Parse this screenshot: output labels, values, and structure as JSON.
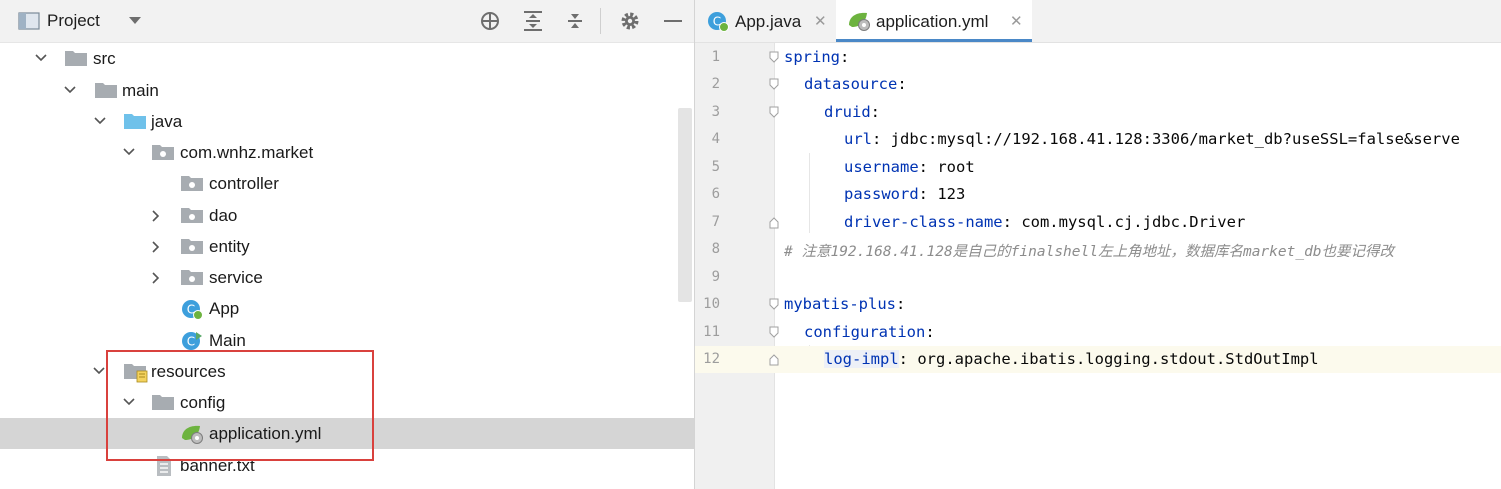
{
  "project_panel": {
    "title": "Project",
    "tree": [
      {
        "label": "src",
        "icon": "folder-icon",
        "expanded": true
      },
      {
        "label": "main",
        "icon": "folder-icon",
        "expanded": true
      },
      {
        "label": "java",
        "icon": "source-folder-icon",
        "expanded": true
      },
      {
        "label": "com.wnhz.market",
        "icon": "package-icon",
        "expanded": true
      },
      {
        "label": "controller",
        "icon": "package-icon"
      },
      {
        "label": "dao",
        "icon": "package-icon",
        "expanded": false
      },
      {
        "label": "entity",
        "icon": "package-icon",
        "expanded": false
      },
      {
        "label": "service",
        "icon": "package-icon",
        "expanded": false
      },
      {
        "label": "App",
        "icon": "spring-class-icon"
      },
      {
        "label": "Main",
        "icon": "class-icon"
      },
      {
        "label": "resources",
        "icon": "resources-folder-icon",
        "expanded": true
      },
      {
        "label": "config",
        "icon": "folder-icon",
        "expanded": true
      },
      {
        "label": "application.yml",
        "icon": "spring-yaml-icon",
        "selected": true
      },
      {
        "label": "banner.txt",
        "icon": "text-file-icon"
      }
    ]
  },
  "editor": {
    "tabs": [
      {
        "label": "App.java",
        "icon": "spring-class-icon",
        "active": false
      },
      {
        "label": "application.yml",
        "icon": "spring-yaml-icon",
        "active": true
      }
    ],
    "lines": [
      {
        "no": "1",
        "key": "spring",
        "sep": ":",
        "value": ""
      },
      {
        "no": "2",
        "key": "datasource",
        "sep": ":",
        "value": ""
      },
      {
        "no": "3",
        "key": "druid",
        "sep": ":",
        "value": ""
      },
      {
        "no": "4",
        "key": "url",
        "sep": ": ",
        "value": "jdbc:mysql://192.168.41.128:3306/market_db?useSSL=false&serve"
      },
      {
        "no": "5",
        "key": "username",
        "sep": ": ",
        "value": "root"
      },
      {
        "no": "6",
        "key": "password",
        "sep": ": ",
        "value": "123"
      },
      {
        "no": "7",
        "key": "driver-class-name",
        "sep": ": ",
        "value": "com.mysql.cj.jdbc.Driver"
      },
      {
        "no": "8",
        "comment": "# 注意192.168.41.128是自己的finalshell左上角地址，数据库名market_db也要记得改"
      },
      {
        "no": "9"
      },
      {
        "no": "10",
        "key": "mybatis-plus",
        "sep": ":",
        "value": ""
      },
      {
        "no": "11",
        "key": "configuration",
        "sep": ":",
        "value": ""
      },
      {
        "no": "12",
        "key": "log-impl",
        "sep": ": ",
        "value": "org.apache.ibatis.logging.stdout.StdOutImpl"
      }
    ]
  },
  "colors": {
    "accent": "#4a88c7",
    "highlight_box": "#d9413d",
    "yaml_key": "#0033b3"
  }
}
